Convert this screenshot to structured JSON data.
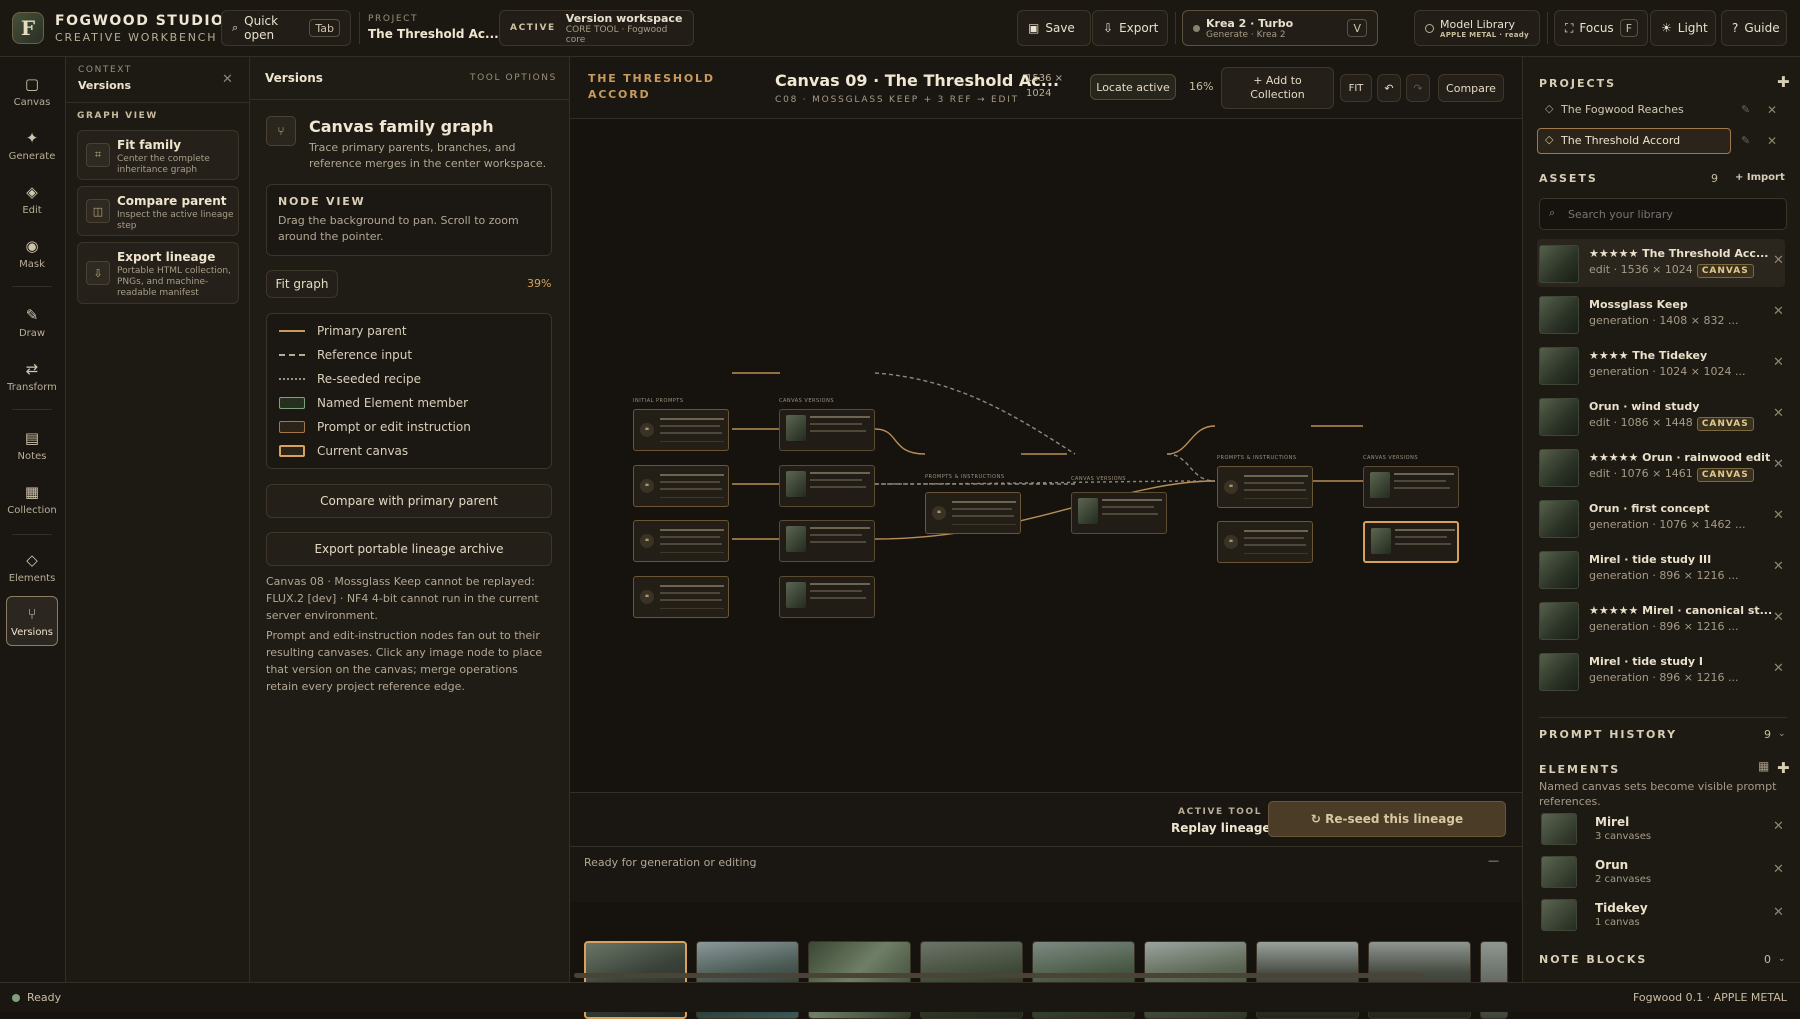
{
  "app": {
    "logo_letter": "F",
    "name": "FOGWOOD STUDIO",
    "subtitle": "CREATIVE WORKBENCH"
  },
  "topbar": {
    "quick_open": {
      "label": "Quick open",
      "key": "Tab"
    },
    "project": {
      "label": "PROJECT",
      "value": "The Threshold Ac..."
    },
    "active": {
      "label": "ACTIVE",
      "title": "Version workspace",
      "sub": "CORE TOOL · Fogwood core"
    },
    "save": "Save",
    "export": "Export",
    "model": {
      "title": "Krea 2 · Turbo",
      "sub": "Generate · Krea 2",
      "key": "V"
    },
    "library": {
      "title": "Model Library",
      "sub": "APPLE METAL · ready"
    },
    "focus": {
      "label": "Focus",
      "key": "F"
    },
    "light": "Light",
    "guide": "Guide"
  },
  "nav": [
    {
      "label": "Canvas",
      "icon": "canvas-icon"
    },
    {
      "label": "Generate",
      "icon": "sparkle-icon"
    },
    {
      "label": "Edit",
      "icon": "edit-icon"
    },
    {
      "label": "Mask",
      "icon": "mask-icon"
    },
    {
      "label": "Draw",
      "icon": "brush-icon"
    },
    {
      "label": "Transform",
      "icon": "transform-icon"
    },
    {
      "label": "Notes",
      "icon": "notes-icon"
    },
    {
      "label": "Collection",
      "icon": "collection-icon"
    },
    {
      "label": "Elements",
      "icon": "elements-icon"
    },
    {
      "label": "Versions",
      "icon": "versions-icon"
    }
  ],
  "context": {
    "label": "CONTEXT",
    "title": "Versions",
    "section": "GRAPH VIEW",
    "cards": [
      {
        "title": "Fit family",
        "desc": "Center the complete inheritance graph"
      },
      {
        "title": "Compare parent",
        "desc": "Inspect the active lineage step"
      },
      {
        "title": "Export lineage",
        "desc": "Portable HTML collection, PNGs, and machine-readable manifest"
      }
    ]
  },
  "panel": {
    "title": "Versions",
    "options": "TOOL OPTIONS",
    "head_title": "Canvas family graph",
    "head_desc": "Trace primary parents, branches, and reference merges in the center workspace.",
    "node_view_title": "NODE VIEW",
    "node_view_desc": "Drag the background to pan. Scroll to zoom around the pointer.",
    "fit_graph": "Fit graph",
    "zoom": "39%",
    "legend": [
      {
        "label": "Primary parent",
        "kind": "solid"
      },
      {
        "label": "Reference input",
        "kind": "dashed"
      },
      {
        "label": "Re-seeded recipe",
        "kind": "dotted"
      },
      {
        "label": "Named Element member",
        "kind": "green"
      },
      {
        "label": "Prompt or edit instruction",
        "kind": "prompt"
      },
      {
        "label": "Current canvas",
        "kind": "current"
      }
    ],
    "compare_btn": "Compare with primary parent",
    "export_btn": "Export portable lineage archive",
    "note1": "Canvas 08 · Mossglass Keep cannot be replayed: FLUX.2 [dev] · NF4 4-bit cannot run in the current server environment.",
    "note2": "Prompt and edit-instruction nodes fan out to their resulting canvases. Click any image node to place that version on the canvas; merge operations retain every project reference edge."
  },
  "canvas": {
    "project": "THE THRESHOLD ACCORD",
    "title": "Canvas 09 · The Threshold Ac...",
    "subtitle": "C08 · MOSSGLASS KEEP + 3 REF → EDIT",
    "dims_w": "1536 ×",
    "dims_h": "1024",
    "locate": "Locate active",
    "zoom": "16%",
    "add_collection": "+ Add to Collection",
    "fit": "FIT",
    "undo": "↶",
    "redo": "↷",
    "compare": "Compare",
    "active_tool_label": "ACTIVE TOOL",
    "active_tool": "Replay lineage",
    "reseed": "↻ Re-seed this lineage",
    "ready": "Ready for generation or editing",
    "collapse": "—",
    "graph_labels": {
      "initial": "INITIAL PROMPTS",
      "versions1": "CANVAS VERSIONS",
      "prompts": "PROMPTS & INSTRUCTIONS",
      "versions2": "CANVAS VERSIONS",
      "prompts2": "PROMPTS & INSTRUCTIONS",
      "versions3": "CANVAS VERSIONS"
    }
  },
  "projects": {
    "title": "PROJECTS",
    "items": [
      {
        "name": "The Fogwood Reaches",
        "active": false
      },
      {
        "name": "The Threshold Accord",
        "active": true
      }
    ]
  },
  "assets": {
    "title": "ASSETS",
    "count": "9",
    "import": "+ Import",
    "search_placeholder": "Search your library",
    "items": [
      {
        "name": "★★★★★ The Threshold Acc...",
        "meta": "edit · 1536 × 1024",
        "badge": "CANVAS"
      },
      {
        "name": "Mossglass Keep",
        "meta": "generation · 1408 × 832 ...",
        "badge": ""
      },
      {
        "name": "★★★★ The Tidekey",
        "meta": "generation · 1024 × 1024 ...",
        "badge": ""
      },
      {
        "name": "Orun · wind study",
        "meta": "edit · 1086 × 1448",
        "badge": "CANVAS"
      },
      {
        "name": "★★★★★ Orun · rainwood edit",
        "meta": "edit · 1076 × 1461",
        "badge": "CANVAS"
      },
      {
        "name": "Orun · first concept",
        "meta": "generation · 1076 × 1462 ...",
        "badge": ""
      },
      {
        "name": "Mirel · tide study III",
        "meta": "generation · 896 × 1216 ...",
        "badge": ""
      },
      {
        "name": "★★★★★ Mirel · canonical st...",
        "meta": "generation · 896 × 1216 ...",
        "badge": ""
      },
      {
        "name": "Mirel · tide study I",
        "meta": "generation · 896 × 1216 ...",
        "badge": ""
      }
    ]
  },
  "prompt_history": {
    "title": "PROMPT HISTORY",
    "count": "9"
  },
  "elements": {
    "title": "ELEMENTS",
    "desc": "Named canvas sets become visible prompt references.",
    "items": [
      {
        "name": "Mirel",
        "count": "3 canvases"
      },
      {
        "name": "Orun",
        "count": "2 canvases"
      },
      {
        "name": "Tidekey",
        "count": "1 canvas"
      }
    ]
  },
  "note_blocks": {
    "title": "NOTE BLOCKS",
    "count": "0"
  },
  "status": {
    "left": "Ready",
    "right": "Fogwood 0.1 · APPLE METAL"
  },
  "colors": {
    "accent": "#c89a5c",
    "bg": "#17140f",
    "border": "#342e24",
    "green": "#7fa07a"
  }
}
